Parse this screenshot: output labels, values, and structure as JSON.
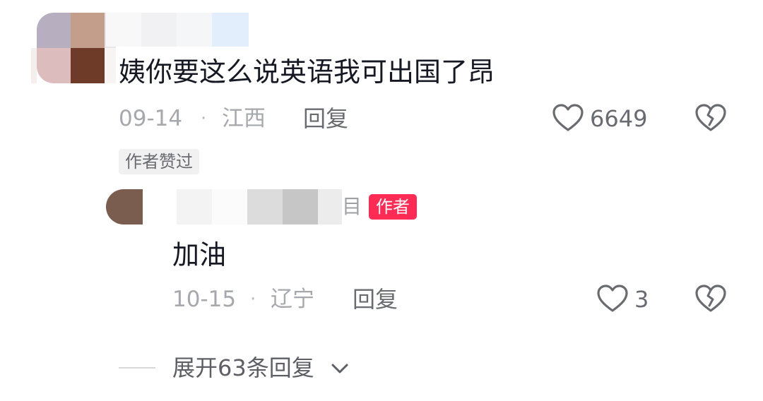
{
  "comment": {
    "text": "姨你要这么说英语我可出国了昂",
    "date": "09-14",
    "separator": "·",
    "location": "江西",
    "reply_label": "回复",
    "like_count": "6649",
    "liked_by_author_label": "作者赞过"
  },
  "reply": {
    "name_suffix": "目",
    "author_badge": "作者",
    "text": "加油",
    "date": "10-15",
    "separator": "·",
    "location": "辽宁",
    "reply_label": "回复",
    "like_count": "3"
  },
  "expand": {
    "label": "展开63条回复"
  },
  "colors": {
    "author_badge": "#fe2c55",
    "meta_text": "#a7a8ad",
    "action_text": "#6a6b71"
  }
}
